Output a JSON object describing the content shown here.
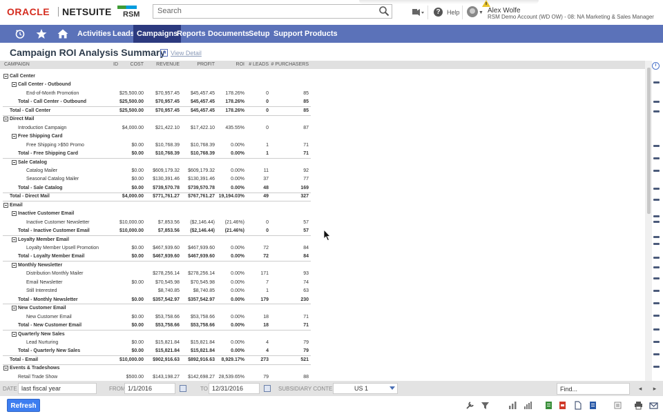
{
  "header": {
    "logo_oracle": "ORACLE",
    "logo_netsuite": "NETSUITE",
    "logo_rsm": "RSM",
    "search_placeholder": "Search",
    "help": "Help",
    "user_name": "Alex Wolfe",
    "user_role": "RSM Demo Account (WD OW) - 08: NA Marketing & Sales Manager"
  },
  "nav": {
    "items": [
      "Activities",
      "Leads",
      "Campaigns",
      "Reports",
      "Documents",
      "Setup",
      "Support",
      "Products"
    ],
    "active": "Campaigns",
    "icons": [
      "recent-records-icon",
      "star-icon",
      "home-icon"
    ]
  },
  "page": {
    "title": "Campaign ROI Analysis Summary",
    "view_detail": "View Detail"
  },
  "table": {
    "columns": [
      "CAMPAIGN",
      "ID",
      "COST",
      "REVENUE",
      "PROFIT",
      "ROI",
      "# LEADS",
      "# PURCHASERS"
    ],
    "rows": [
      {
        "level": 0,
        "type": "group",
        "name": "Call Center",
        "id": "",
        "cost": "",
        "revenue": "",
        "profit": "",
        "roi": "",
        "leads": "",
        "purchasers": ""
      },
      {
        "level": 1,
        "type": "group",
        "name": "Call Center - Outbound",
        "id": "",
        "cost": "",
        "revenue": "",
        "profit": "",
        "roi": "",
        "leads": "",
        "purchasers": ""
      },
      {
        "level": 2,
        "type": "item",
        "name": "End-of-Month Promotion",
        "id": "",
        "cost": "$25,500.00",
        "revenue": "$70,957.45",
        "profit": "$45,457.45",
        "roi": "178.26%",
        "leads": "0",
        "purchasers": "85"
      },
      {
        "level": 1,
        "type": "total",
        "name": "Total - Call Center - Outbound",
        "id": "",
        "cost": "$25,500.00",
        "revenue": "$70,957.45",
        "profit": "$45,457.45",
        "roi": "178.26%",
        "leads": "0",
        "purchasers": "85"
      },
      {
        "level": 0,
        "type": "total",
        "name": "Total - Call Center",
        "id": "",
        "cost": "$25,500.00",
        "revenue": "$70,957.45",
        "profit": "$45,457.45",
        "roi": "178.26%",
        "leads": "0",
        "purchasers": "85"
      },
      {
        "level": 0,
        "type": "group",
        "name": "Direct Mail",
        "id": "",
        "cost": "",
        "revenue": "",
        "profit": "",
        "roi": "",
        "leads": "",
        "purchasers": ""
      },
      {
        "level": 1,
        "type": "item",
        "name": "Introduction Campaign",
        "id": "",
        "cost": "$4,000.00",
        "revenue": "$21,422.10",
        "profit": "$17,422.10",
        "roi": "435.55%",
        "leads": "0",
        "purchasers": "87"
      },
      {
        "level": 1,
        "type": "group",
        "name": "Free Shipping Card",
        "id": "",
        "cost": "",
        "revenue": "",
        "profit": "",
        "roi": "",
        "leads": "",
        "purchasers": ""
      },
      {
        "level": 2,
        "type": "item",
        "name": "Free Shipping >$50 Promo",
        "id": "",
        "cost": "$0.00",
        "revenue": "$10,768.39",
        "profit": "$10,768.39",
        "roi": "0.00%",
        "leads": "1",
        "purchasers": "71"
      },
      {
        "level": 1,
        "type": "total",
        "name": "Total - Free Shipping Card",
        "id": "",
        "cost": "$0.00",
        "revenue": "$10,768.39",
        "profit": "$10,768.39",
        "roi": "0.00%",
        "leads": "1",
        "purchasers": "71"
      },
      {
        "level": 1,
        "type": "group",
        "name": "Sale Catalog",
        "id": "",
        "cost": "",
        "revenue": "",
        "profit": "",
        "roi": "",
        "leads": "",
        "purchasers": ""
      },
      {
        "level": 2,
        "type": "item",
        "name": "Catalog Mailer",
        "id": "",
        "cost": "$0.00",
        "revenue": "$609,179.32",
        "profit": "$609,179.32",
        "roi": "0.00%",
        "leads": "11",
        "purchasers": "92"
      },
      {
        "level": 2,
        "type": "item",
        "name": "Seasonal Catalog Mailer",
        "id": "",
        "cost": "$0.00",
        "revenue": "$130,391.46",
        "profit": "$130,391.46",
        "roi": "0.00%",
        "leads": "37",
        "purchasers": "77"
      },
      {
        "level": 1,
        "type": "total",
        "name": "Total - Sale Catalog",
        "id": "",
        "cost": "$0.00",
        "revenue": "$739,570.78",
        "profit": "$739,570.78",
        "roi": "0.00%",
        "leads": "48",
        "purchasers": "169"
      },
      {
        "level": 0,
        "type": "total",
        "name": "Total - Direct Mail",
        "id": "",
        "cost": "$4,000.00",
        "revenue": "$771,761.27",
        "profit": "$767,761.27",
        "roi": "19,194.03%",
        "leads": "49",
        "purchasers": "327"
      },
      {
        "level": 0,
        "type": "group",
        "name": "Email",
        "id": "",
        "cost": "",
        "revenue": "",
        "profit": "",
        "roi": "",
        "leads": "",
        "purchasers": ""
      },
      {
        "level": 1,
        "type": "group",
        "name": "Inactive Customer Email",
        "id": "",
        "cost": "",
        "revenue": "",
        "profit": "",
        "roi": "",
        "leads": "",
        "purchasers": ""
      },
      {
        "level": 2,
        "type": "item",
        "name": "Inactive Customer Newsletter",
        "id": "",
        "cost": "$10,000.00",
        "revenue": "$7,853.56",
        "profit": "($2,146.44)",
        "roi": "(21.46%)",
        "leads": "0",
        "purchasers": "57"
      },
      {
        "level": 1,
        "type": "total",
        "name": "Total - Inactive Customer Email",
        "id": "",
        "cost": "$10,000.00",
        "revenue": "$7,853.56",
        "profit": "($2,146.44)",
        "roi": "(21.46%)",
        "leads": "0",
        "purchasers": "57"
      },
      {
        "level": 1,
        "type": "group",
        "name": "Loyalty Member Email",
        "id": "",
        "cost": "",
        "revenue": "",
        "profit": "",
        "roi": "",
        "leads": "",
        "purchasers": ""
      },
      {
        "level": 2,
        "type": "item",
        "name": "Loyalty Member Upsell Promotion",
        "id": "",
        "cost": "$0.00",
        "revenue": "$467,939.60",
        "profit": "$467,939.60",
        "roi": "0.00%",
        "leads": "72",
        "purchasers": "84"
      },
      {
        "level": 1,
        "type": "total",
        "name": "Total - Loyalty Member Email",
        "id": "",
        "cost": "$0.00",
        "revenue": "$467,939.60",
        "profit": "$467,939.60",
        "roi": "0.00%",
        "leads": "72",
        "purchasers": "84"
      },
      {
        "level": 1,
        "type": "group",
        "name": "Monthly Newsletter",
        "id": "",
        "cost": "",
        "revenue": "",
        "profit": "",
        "roi": "",
        "leads": "",
        "purchasers": ""
      },
      {
        "level": 2,
        "type": "item",
        "name": "Distribution Monthly Mailer",
        "id": "",
        "cost": "",
        "revenue": "$278,256.14",
        "profit": "$278,256.14",
        "roi": "0.00%",
        "leads": "171",
        "purchasers": "93"
      },
      {
        "level": 2,
        "type": "item",
        "name": "Email Newsletter",
        "id": "",
        "cost": "$0.00",
        "revenue": "$70,545.98",
        "profit": "$70,545.98",
        "roi": "0.00%",
        "leads": "7",
        "purchasers": "74"
      },
      {
        "level": 2,
        "type": "item",
        "name": "Still Interested",
        "id": "",
        "cost": "",
        "revenue": "$8,740.85",
        "profit": "$8,740.85",
        "roi": "0.00%",
        "leads": "1",
        "purchasers": "63"
      },
      {
        "level": 1,
        "type": "total",
        "name": "Total - Monthly Newsletter",
        "id": "",
        "cost": "$0.00",
        "revenue": "$357,542.97",
        "profit": "$357,542.97",
        "roi": "0.00%",
        "leads": "179",
        "purchasers": "230"
      },
      {
        "level": 1,
        "type": "group",
        "name": "New Customer Email",
        "id": "",
        "cost": "",
        "revenue": "",
        "profit": "",
        "roi": "",
        "leads": "",
        "purchasers": ""
      },
      {
        "level": 2,
        "type": "item",
        "name": "New Customer Email",
        "id": "",
        "cost": "$0.00",
        "revenue": "$53,758.66",
        "profit": "$53,758.66",
        "roi": "0.00%",
        "leads": "18",
        "purchasers": "71"
      },
      {
        "level": 1,
        "type": "total",
        "name": "Total - New Customer Email",
        "id": "",
        "cost": "$0.00",
        "revenue": "$53,758.66",
        "profit": "$53,758.66",
        "roi": "0.00%",
        "leads": "18",
        "purchasers": "71"
      },
      {
        "level": 1,
        "type": "group",
        "name": "Quarterly New Sales",
        "id": "",
        "cost": "",
        "revenue": "",
        "profit": "",
        "roi": "",
        "leads": "",
        "purchasers": ""
      },
      {
        "level": 2,
        "type": "item",
        "name": "Lead Nurturing",
        "id": "",
        "cost": "$0.00",
        "revenue": "$15,821.84",
        "profit": "$15,821.84",
        "roi": "0.00%",
        "leads": "4",
        "purchasers": "79"
      },
      {
        "level": 1,
        "type": "total",
        "name": "Total - Quarterly New Sales",
        "id": "",
        "cost": "$0.00",
        "revenue": "$15,821.84",
        "profit": "$15,821.84",
        "roi": "0.00%",
        "leads": "4",
        "purchasers": "79"
      },
      {
        "level": 0,
        "type": "total",
        "name": "Total - Email",
        "id": "",
        "cost": "$10,000.00",
        "revenue": "$902,916.63",
        "profit": "$892,916.63",
        "roi": "8,929.17%",
        "leads": "273",
        "purchasers": "521"
      },
      {
        "level": 0,
        "type": "group",
        "name": "Events & Tradeshows",
        "id": "",
        "cost": "",
        "revenue": "",
        "profit": "",
        "roi": "",
        "leads": "",
        "purchasers": ""
      },
      {
        "level": 1,
        "type": "item",
        "name": "Retail Trade Show",
        "id": "",
        "cost": "$500.00",
        "revenue": "$143,198.27",
        "profit": "$142,698.27",
        "roi": "28,539.65%",
        "leads": "79",
        "purchasers": "88"
      }
    ]
  },
  "filters": {
    "date_label": "DATE",
    "date_value": "last fiscal year",
    "from_label": "FROM",
    "from_value": "1/1/2016",
    "to_label": "TO",
    "to_value": "12/31/2016",
    "subsidiary_label": "SUBSIDIARY CONTEXT",
    "subsidiary_value": "US 1",
    "find_placeholder": "Find..."
  },
  "footer": {
    "refresh": "Refresh"
  },
  "colors": {
    "nav_bg": "#5b72b9",
    "nav_active": "#2c3a7f",
    "refresh_btn": "#3d7ef0",
    "oracle_red": "#d52b1e"
  }
}
